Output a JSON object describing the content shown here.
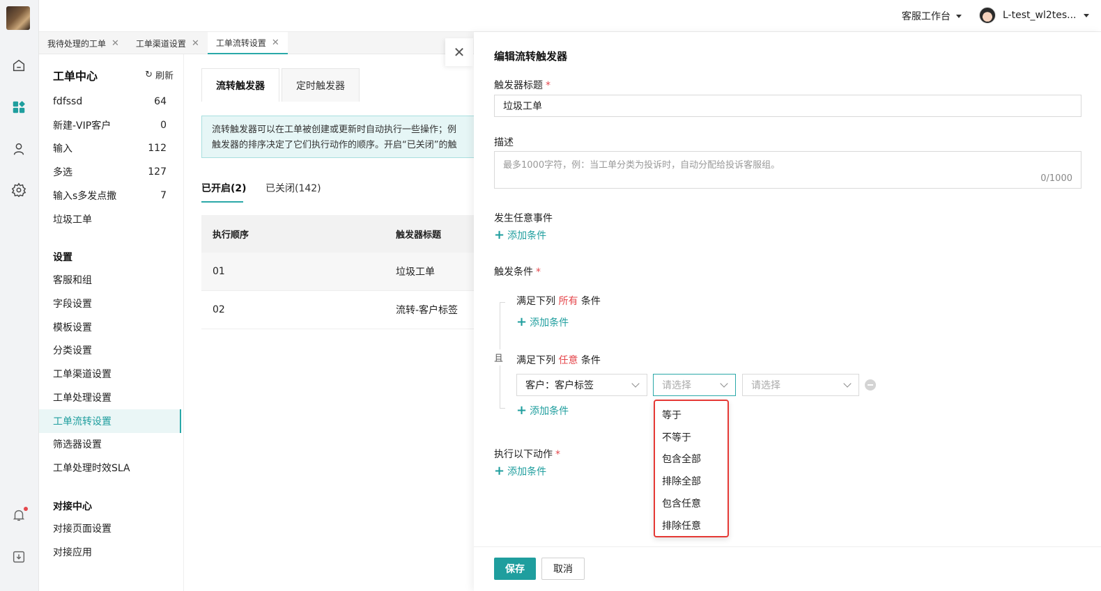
{
  "rail": {
    "items": [
      "home-icon",
      "apps-icon",
      "user-icon",
      "settings-icon"
    ],
    "bottom": [
      "bell-icon",
      "download-icon"
    ]
  },
  "topbar": {
    "workspace": "客服工作台",
    "user": "L-test_wl2tes..."
  },
  "tabs": [
    {
      "label": "我待处理的工单"
    },
    {
      "label": "工单渠道设置"
    },
    {
      "label": "工单流转设置"
    }
  ],
  "menu": {
    "title": "工单中心",
    "refresh": "刷新",
    "views": [
      {
        "label": "fdfssd",
        "count": "64"
      },
      {
        "label": "新建-VIP客户",
        "count": "0"
      },
      {
        "label": "输入",
        "count": "112"
      },
      {
        "label": "多选",
        "count": "127"
      },
      {
        "label": "输入s多发点撒",
        "count": "7"
      },
      {
        "label": "垃圾工单",
        "count": ""
      }
    ],
    "settings_title": "设置",
    "settings": [
      "客服和组",
      "字段设置",
      "模板设置",
      "分类设置",
      "工单渠道设置",
      "工单处理设置",
      "工单流转设置",
      "筛选器设置",
      "工单处理时效SLA"
    ],
    "integration_title": "对接中心",
    "integration": [
      "对接页面设置",
      "对接应用"
    ]
  },
  "main": {
    "subtabs": [
      "流转触发器",
      "定时触发器"
    ],
    "info_line1": "流转触发器可以在工单被创建或更新时自动执行一些操作；例",
    "info_line2": "触发器的排序决定了它们执行动作的顺序。开启“已关闭”的触",
    "status_tabs": [
      "已开启(2)",
      "已关闭(142)"
    ],
    "columns": [
      "执行顺序",
      "触发器标题"
    ],
    "rows": [
      {
        "order": "01",
        "title": "垃圾工单"
      },
      {
        "order": "02",
        "title": "流转-客户标签"
      }
    ]
  },
  "drawer": {
    "title": "编辑流转触发器",
    "trigger_title_label": "触发器标题",
    "trigger_title_value": "垃圾工单",
    "desc_label": "描述",
    "desc_placeholder": "最多1000字符，例：当工单分类为投诉时，自动分配给投诉客服组。",
    "desc_count": "0/1000",
    "event_label": "发生任意事件",
    "add_condition": "添加条件",
    "trigger_cond_label": "触发条件",
    "all_prefix": "满足下列",
    "all_word": "所有",
    "suffix": "条件",
    "any_word": "任意",
    "and_label": "且",
    "cond_field": "客户：客户标签",
    "select_placeholder": "请选择",
    "operators": [
      "等于",
      "不等于",
      "包含全部",
      "排除全部",
      "包含任意",
      "排除任意"
    ],
    "actions_label": "执行以下动作",
    "save": "保存",
    "cancel": "取消"
  }
}
